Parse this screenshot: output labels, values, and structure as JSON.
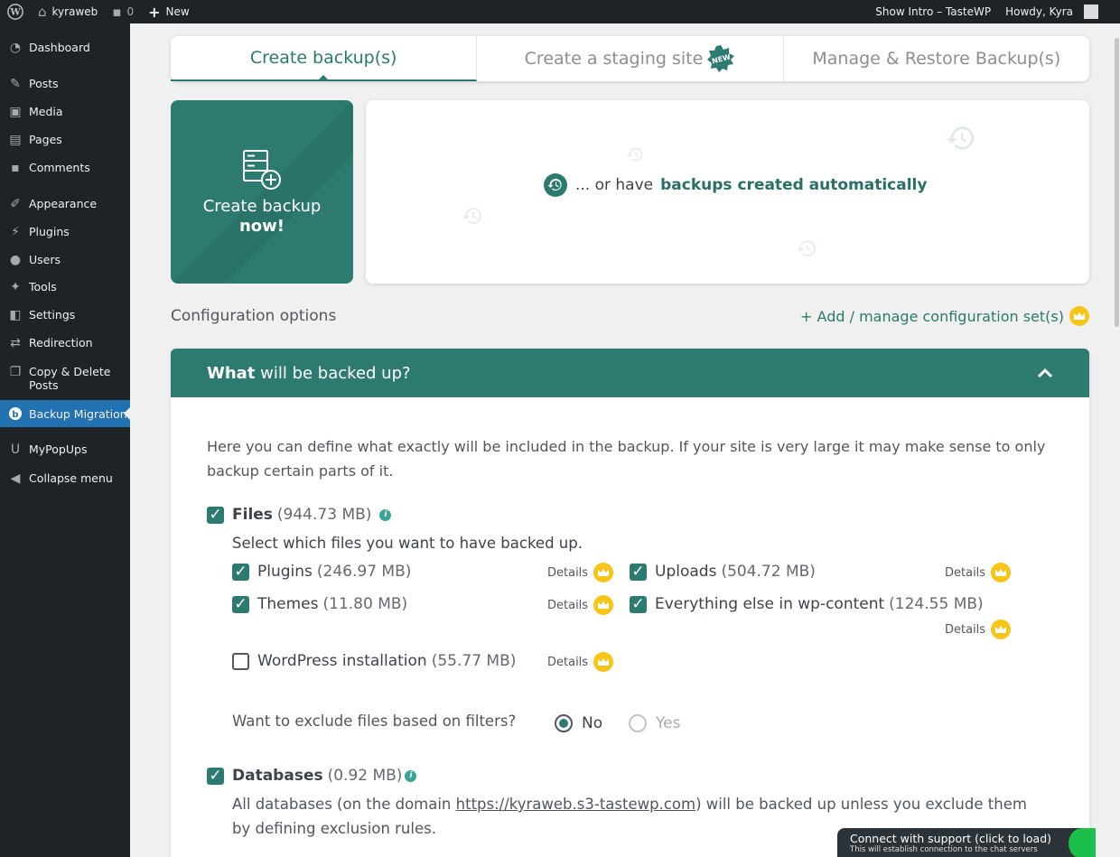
{
  "adminbar": {
    "site_name": "kyraweb",
    "comments_count": "0",
    "new_label": "New",
    "show_intro": "Show Intro – TasteWP",
    "howdy": "Howdy, Kyra"
  },
  "sidebar": {
    "items": [
      {
        "label": "Dashboard",
        "icon": "dashboard-icon"
      },
      {
        "label": "Posts",
        "icon": "pin-icon"
      },
      {
        "label": "Media",
        "icon": "media-icon"
      },
      {
        "label": "Pages",
        "icon": "pages-icon"
      },
      {
        "label": "Comments",
        "icon": "comment-icon"
      },
      {
        "label": "Appearance",
        "icon": "brush-icon"
      },
      {
        "label": "Plugins",
        "icon": "plug-icon"
      },
      {
        "label": "Users",
        "icon": "user-icon"
      },
      {
        "label": "Tools",
        "icon": "wrench-icon"
      },
      {
        "label": "Settings",
        "icon": "settings-icon"
      },
      {
        "label": "Redirection",
        "icon": "redirect-icon"
      },
      {
        "label": "Copy & Delete Posts",
        "icon": "copy-icon"
      },
      {
        "label": "Backup Migration",
        "icon": "backup-icon"
      },
      {
        "label": "MyPopUps",
        "icon": "popup-icon"
      },
      {
        "label": "Collapse menu",
        "icon": "collapse-icon"
      }
    ],
    "active": "Backup Migration"
  },
  "tabs": [
    {
      "label": "Create backup(s)",
      "active": true
    },
    {
      "label": "Create a staging site",
      "badge": "NEW"
    },
    {
      "label": "Manage & Restore Backup(s)"
    }
  ],
  "create_card": {
    "line1": "Create backup",
    "line2": "now!"
  },
  "auto_card": {
    "prefix": "... or have",
    "highlight": "backups created automatically"
  },
  "config": {
    "title": "Configuration options",
    "link": "+ Add / manage configuration set(s)"
  },
  "panel": {
    "title_bold": "What",
    "title_rest": " will be backed up?",
    "intro": "Here you can define what exactly will be included in the backup. If your site is very large it may make sense to only backup certain parts of it.",
    "files": {
      "label": "Files",
      "size": "(944.73 MB)",
      "checked": true
    },
    "files_sub": "Select which files you want to have backed up.",
    "plugins": {
      "label": "Plugins",
      "size": "(246.97 MB)",
      "checked": true
    },
    "themes": {
      "label": "Themes",
      "size": "(11.80 MB)",
      "checked": true
    },
    "wpinstall": {
      "label": "WordPress installation",
      "size": "(55.77 MB)",
      "checked": false
    },
    "uploads": {
      "label": "Uploads",
      "size": "(504.72 MB)",
      "checked": true
    },
    "everything": {
      "label": "Everything else in wp-content",
      "size": "(124.55 MB)",
      "checked": true
    },
    "details_label": "Details",
    "exclude_question": "Want to exclude files based on filters?",
    "radio_no": "No",
    "radio_yes": "Yes",
    "exclude_selected": "No",
    "databases": {
      "label": "Databases",
      "size": "(0.92 MB)",
      "checked": true
    },
    "db_text_before": "All databases (on the domain ",
    "db_link": "https://kyraweb.s3-tastewp.com",
    "db_text_after": ") will be backed up unless you exclude them by defining exclusion rules."
  },
  "support": {
    "title": "Connect with support (click to load)",
    "subtitle": "This will establish connection to the chat servers"
  },
  "colors": {
    "accent": "#2d7b70",
    "crown": "#f7c518",
    "admin_bg": "#1d2327",
    "active_menu": "#2271b1"
  }
}
